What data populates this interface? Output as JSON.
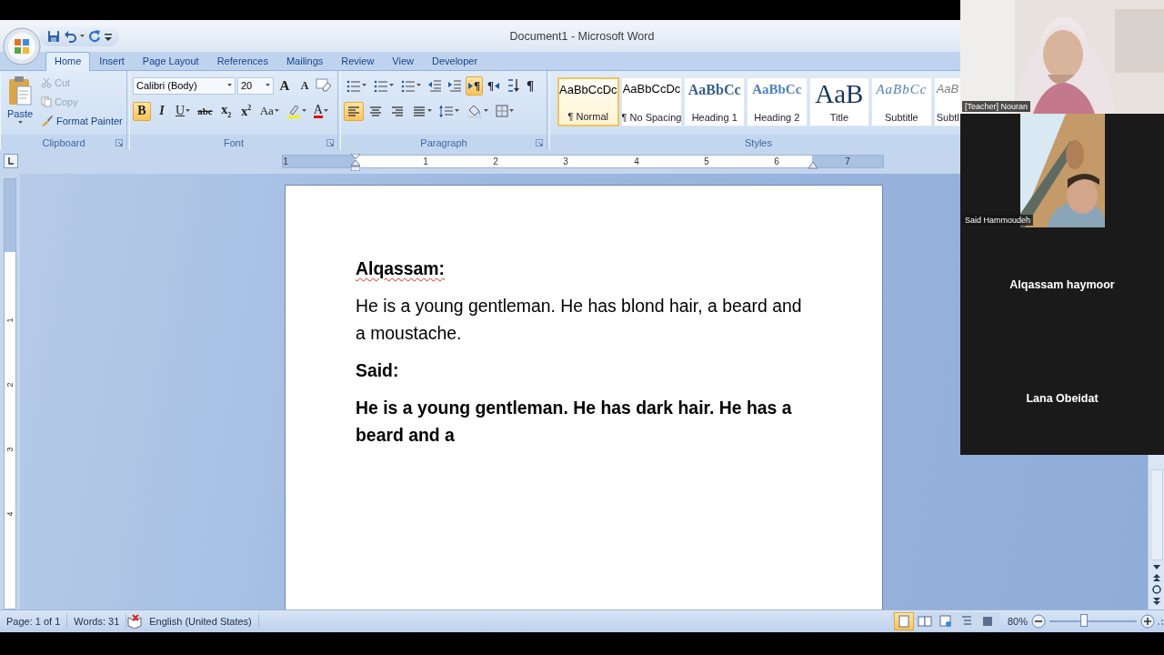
{
  "window": {
    "title": "Document1 - Microsoft Word"
  },
  "tabs": [
    {
      "label": "Home",
      "selected": true
    },
    {
      "label": "Insert",
      "selected": false
    },
    {
      "label": "Page Layout",
      "selected": false
    },
    {
      "label": "References",
      "selected": false
    },
    {
      "label": "Mailings",
      "selected": false
    },
    {
      "label": "Review",
      "selected": false
    },
    {
      "label": "View",
      "selected": false
    },
    {
      "label": "Developer",
      "selected": false
    }
  ],
  "clipboard": {
    "group_label": "Clipboard",
    "paste": "Paste",
    "cut": {
      "label": "Cut",
      "disabled": true
    },
    "copy": {
      "label": "Copy",
      "disabled": true
    },
    "format_painter": {
      "label": "Format Painter",
      "disabled": false
    }
  },
  "font": {
    "group_label": "Font",
    "name": "Calibri (Body)",
    "size": "20",
    "grow": "A",
    "shrink": "A",
    "buttons": [
      {
        "label": "B",
        "kind": "bold",
        "selected": true
      },
      {
        "label": "I",
        "kind": "italic",
        "selected": false
      },
      {
        "label": "U",
        "kind": "underline",
        "selected": false
      },
      {
        "label": "abc",
        "kind": "strike",
        "selected": false
      },
      {
        "label": "x$_{2}$",
        "kind": "sub",
        "selected": false
      },
      {
        "label": "x$^{2}$",
        "kind": "sup",
        "selected": false
      },
      {
        "label": "Aa",
        "kind": "case",
        "selected": false
      }
    ],
    "color_label": "A"
  },
  "paragraph": {
    "group_label": "Paragraph",
    "ltr": {
      "label": "¶",
      "selected": true
    },
    "rtl": {
      "label": "¶",
      "selected": false
    },
    "marks": {
      "label": "¶",
      "selected": false
    },
    "align": [
      {
        "kind": "left",
        "selected": true
      },
      {
        "kind": "center",
        "selected": false
      },
      {
        "kind": "right",
        "selected": false
      },
      {
        "kind": "justify",
        "selected": false
      }
    ]
  },
  "styles": {
    "group_label": "Styles",
    "items": [
      {
        "preview": "AaBbCcDc",
        "name": "¶ Normal",
        "kind": "normal",
        "selected": true
      },
      {
        "preview": "AaBbCcDc",
        "name": "¶ No Spacing",
        "kind": "normal",
        "selected": false
      },
      {
        "preview": "AaBbCc",
        "name": "Heading 1",
        "kind": "heading1",
        "selected": false
      },
      {
        "preview": "AaBbCc",
        "name": "Heading 2",
        "kind": "heading2",
        "selected": false
      },
      {
        "preview": "AaB",
        "name": "Title",
        "kind": "title",
        "selected": false
      },
      {
        "preview": "AaBbCc",
        "name": "Subtitle",
        "kind": "subtitle",
        "selected": false
      },
      {
        "preview": "AaB",
        "name": "Subtl",
        "kind": "subtle",
        "selected": false
      }
    ]
  },
  "ruler": {
    "labels": [
      "1",
      "1",
      "2",
      "3",
      "4",
      "5",
      "6",
      "7"
    ]
  },
  "vertical_ruler": {
    "labels": [
      "1",
      "2",
      "3",
      "4"
    ]
  },
  "document": {
    "paragraphs": [
      {
        "kind": "label",
        "text": "Alqassam:",
        "misspelled": true
      },
      {
        "kind": "text",
        "text": "He is a young gentleman. He has blond hair, a beard and a moustache.",
        "misspelled": false
      },
      {
        "kind": "label",
        "text": "Said:",
        "misspelled": false
      },
      {
        "kind": "bold-text",
        "text": "He is a young gentleman. He has dark hair. He has a beard and a",
        "misspelled": false
      }
    ]
  },
  "status_bar": {
    "page": "Page: 1 of 1",
    "words": "Words: 31",
    "language": "English (United States)",
    "zoom": "80%",
    "zoom_slider": {
      "level": 0.4
    },
    "views": [
      {
        "kind": "print",
        "selected": true
      },
      {
        "kind": "reading",
        "selected": false
      },
      {
        "kind": "web",
        "selected": false
      },
      {
        "kind": "outline",
        "selected": false
      },
      {
        "kind": "draft",
        "selected": false
      }
    ]
  },
  "meeting": {
    "participants": [
      {
        "name": "[Teacher] Nouran",
        "kind": "video"
      },
      {
        "name": "Said Hammoudeh",
        "kind": "video-small"
      },
      {
        "name": "Alqassam haymoor",
        "kind": "name"
      },
      {
        "name": "Lana Obeidat",
        "kind": "name"
      }
    ]
  }
}
